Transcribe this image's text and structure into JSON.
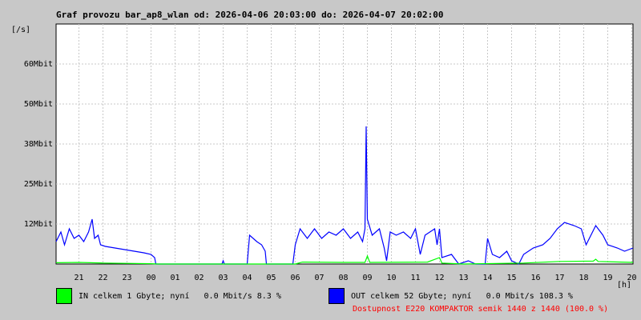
{
  "title": "Graf provozu bar_ap8_wlan od: 2026-04-06 20:03:00 do: 2026-04-07 20:02:00",
  "chart_data": {
    "type": "line",
    "ylabel": "[/s]",
    "xlabel": "[h]",
    "y_ticks": [
      {
        "label": "12Mbit",
        "value": 12.5
      },
      {
        "label": "25Mbit",
        "value": 25
      },
      {
        "label": "38Mbit",
        "value": 37.5
      },
      {
        "label": "50Mbit",
        "value": 50
      },
      {
        "label": "60Mbit",
        "value": 62.5
      }
    ],
    "ylim": [
      0,
      75
    ],
    "xlim": [
      20.05,
      44.05
    ],
    "x_ticks": [
      {
        "label": "21",
        "value": 21
      },
      {
        "label": "22",
        "value": 22
      },
      {
        "label": "23",
        "value": 23
      },
      {
        "label": "00",
        "value": 24
      },
      {
        "label": "01",
        "value": 25
      },
      {
        "label": "02",
        "value": 26
      },
      {
        "label": "03",
        "value": 27
      },
      {
        "label": "04",
        "value": 28
      },
      {
        "label": "05",
        "value": 29
      },
      {
        "label": "06",
        "value": 30
      },
      {
        "label": "07",
        "value": 31
      },
      {
        "label": "08",
        "value": 32
      },
      {
        "label": "09",
        "value": 33
      },
      {
        "label": "10",
        "value": 34
      },
      {
        "label": "11",
        "value": 35
      },
      {
        "label": "12",
        "value": 36
      },
      {
        "label": "13",
        "value": 37
      },
      {
        "label": "14",
        "value": 38
      },
      {
        "label": "15",
        "value": 39
      },
      {
        "label": "16",
        "value": 40
      },
      {
        "label": "17",
        "value": 41
      },
      {
        "label": "18",
        "value": 42
      },
      {
        "label": "19",
        "value": 43
      },
      {
        "label": "20",
        "value": 44
      }
    ],
    "series": [
      {
        "name": "OUT",
        "color": "#0000ff",
        "points": [
          [
            20.05,
            7
          ],
          [
            20.25,
            10
          ],
          [
            20.4,
            6
          ],
          [
            20.6,
            11
          ],
          [
            20.8,
            8
          ],
          [
            21.0,
            9
          ],
          [
            21.2,
            7
          ],
          [
            21.4,
            10
          ],
          [
            21.55,
            14
          ],
          [
            21.65,
            8
          ],
          [
            21.8,
            9
          ],
          [
            21.9,
            6
          ],
          [
            22.1,
            5.5
          ],
          [
            22.5,
            5
          ],
          [
            22.9,
            4.5
          ],
          [
            23.3,
            4
          ],
          [
            23.7,
            3.5
          ],
          [
            24.0,
            3
          ],
          [
            24.15,
            2
          ],
          [
            24.2,
            0
          ],
          [
            26.95,
            0
          ],
          [
            27.0,
            1
          ],
          [
            27.05,
            0
          ],
          [
            28.0,
            0
          ],
          [
            28.1,
            9
          ],
          [
            28.4,
            7
          ],
          [
            28.6,
            6
          ],
          [
            28.75,
            4
          ],
          [
            28.8,
            0
          ],
          [
            29.9,
            0
          ],
          [
            30.0,
            6
          ],
          [
            30.2,
            11
          ],
          [
            30.5,
            8
          ],
          [
            30.8,
            11
          ],
          [
            31.1,
            8
          ],
          [
            31.4,
            10
          ],
          [
            31.7,
            9
          ],
          [
            32.0,
            11
          ],
          [
            32.3,
            8
          ],
          [
            32.6,
            10
          ],
          [
            32.8,
            7
          ],
          [
            32.9,
            11
          ],
          [
            32.95,
            43
          ],
          [
            33.0,
            14
          ],
          [
            33.2,
            9
          ],
          [
            33.5,
            11
          ],
          [
            33.7,
            5
          ],
          [
            33.8,
            1
          ],
          [
            33.95,
            10
          ],
          [
            34.2,
            9
          ],
          [
            34.5,
            10
          ],
          [
            34.8,
            8
          ],
          [
            35.0,
            11
          ],
          [
            35.2,
            3
          ],
          [
            35.4,
            9
          ],
          [
            35.6,
            10
          ],
          [
            35.8,
            11
          ],
          [
            35.9,
            6
          ],
          [
            36.0,
            11
          ],
          [
            36.1,
            2
          ],
          [
            36.5,
            3
          ],
          [
            36.8,
            0
          ],
          [
            37.2,
            1
          ],
          [
            37.5,
            0
          ],
          [
            37.9,
            0
          ],
          [
            38.0,
            8
          ],
          [
            38.2,
            3
          ],
          [
            38.5,
            2
          ],
          [
            38.8,
            4
          ],
          [
            39.0,
            1
          ],
          [
            39.3,
            0
          ],
          [
            39.5,
            3
          ],
          [
            39.9,
            5
          ],
          [
            40.3,
            6
          ],
          [
            40.6,
            8
          ],
          [
            40.9,
            11
          ],
          [
            41.2,
            13
          ],
          [
            41.6,
            12
          ],
          [
            41.9,
            11
          ],
          [
            42.1,
            6
          ],
          [
            42.3,
            9
          ],
          [
            42.5,
            12
          ],
          [
            42.8,
            9
          ],
          [
            43.0,
            6
          ],
          [
            43.4,
            5
          ],
          [
            43.7,
            4
          ],
          [
            44.05,
            5
          ]
        ]
      },
      {
        "name": "IN",
        "color": "#00ff00",
        "points": [
          [
            20.05,
            0.4
          ],
          [
            21.0,
            0.5
          ],
          [
            22.0,
            0.3
          ],
          [
            23.0,
            0.2
          ],
          [
            24.0,
            0.1
          ],
          [
            24.3,
            0
          ],
          [
            30.0,
            0
          ],
          [
            30.3,
            0.6
          ],
          [
            32.0,
            0.5
          ],
          [
            32.9,
            0.5
          ],
          [
            33.0,
            2.5
          ],
          [
            33.1,
            0.5
          ],
          [
            35.5,
            0.6
          ],
          [
            36.0,
            2.0
          ],
          [
            36.1,
            0.3
          ],
          [
            37.0,
            0
          ],
          [
            39.5,
            0.3
          ],
          [
            41.0,
            0.8
          ],
          [
            42.4,
            0.9
          ],
          [
            42.5,
            1.5
          ],
          [
            42.6,
            0.8
          ],
          [
            44.05,
            0.5
          ]
        ]
      }
    ]
  },
  "legend": {
    "in_text": "IN celkem 1 Gbyte; nyní   0.0 Mbit/s 8.3 %",
    "in_color": "#00ff00",
    "out_text": "OUT celkem 52 Gbyte; nyní   0.0 Mbit/s 108.3 %",
    "out_color": "#0000ff"
  },
  "availability": "Dostupnost E220 KOMPAKTOR semik 1440 z 1440 (100.0 %)",
  "availability_color": "#ff0000"
}
